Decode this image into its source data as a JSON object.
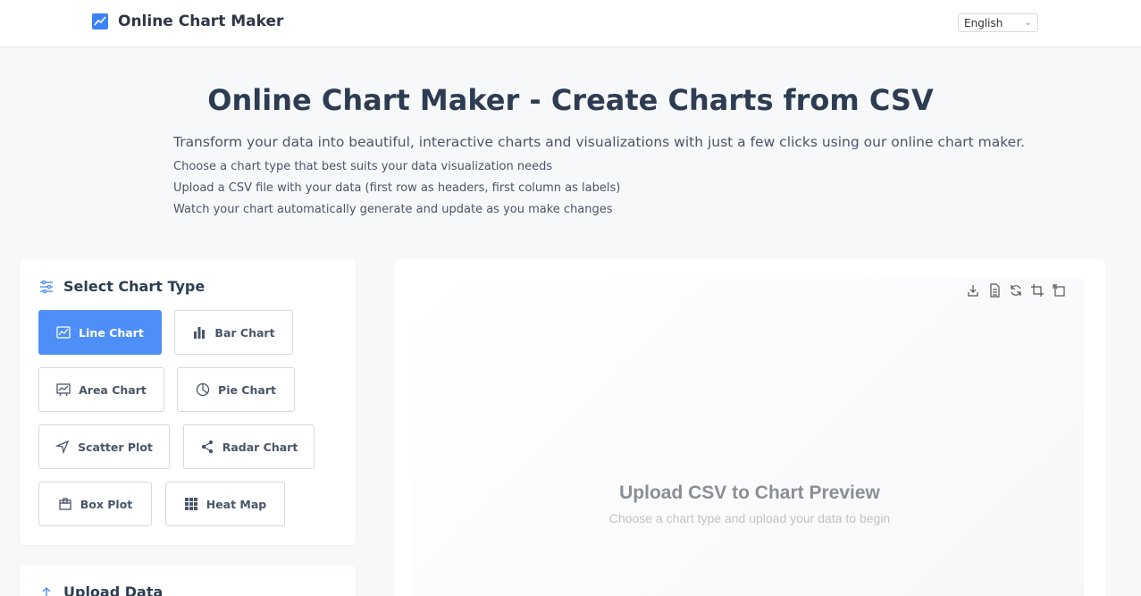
{
  "header": {
    "brand": "Online Chart Maker",
    "language": "English"
  },
  "hero": {
    "title": "Online Chart Maker - Create Charts from CSV",
    "subtitle": "Transform your data into beautiful, interactive charts and visualizations with just a few clicks using our online chart maker.",
    "steps": [
      "Choose a chart type that best suits your data visualization needs",
      "Upload a CSV file with your data (first row as headers, first column as labels)",
      "Watch your chart automatically generate and update as you make changes"
    ]
  },
  "chart_types": {
    "title": "Select Chart Type",
    "items": [
      {
        "label": "Line Chart",
        "icon": "line-chart-icon",
        "active": true
      },
      {
        "label": "Bar Chart",
        "icon": "bar-chart-icon",
        "active": false
      },
      {
        "label": "Area Chart",
        "icon": "area-chart-icon",
        "active": false
      },
      {
        "label": "Pie Chart",
        "icon": "pie-chart-icon",
        "active": false
      },
      {
        "label": "Scatter Plot",
        "icon": "scatter-icon",
        "active": false
      },
      {
        "label": "Radar Chart",
        "icon": "share-icon",
        "active": false
      },
      {
        "label": "Box Plot",
        "icon": "box-icon",
        "active": false
      },
      {
        "label": "Heat Map",
        "icon": "grid-icon",
        "active": false
      }
    ]
  },
  "upload": {
    "title": "Upload Data"
  },
  "preview": {
    "placeholder_title": "Upload CSV to Chart Preview",
    "placeholder_subtitle": "Choose a chart type and upload your data to begin",
    "tools": [
      "download-icon",
      "document-icon",
      "refresh-icon",
      "crop-icon",
      "resize-icon"
    ]
  },
  "colors": {
    "accent": "#4e8ef7",
    "heading": "#2d3c52"
  }
}
